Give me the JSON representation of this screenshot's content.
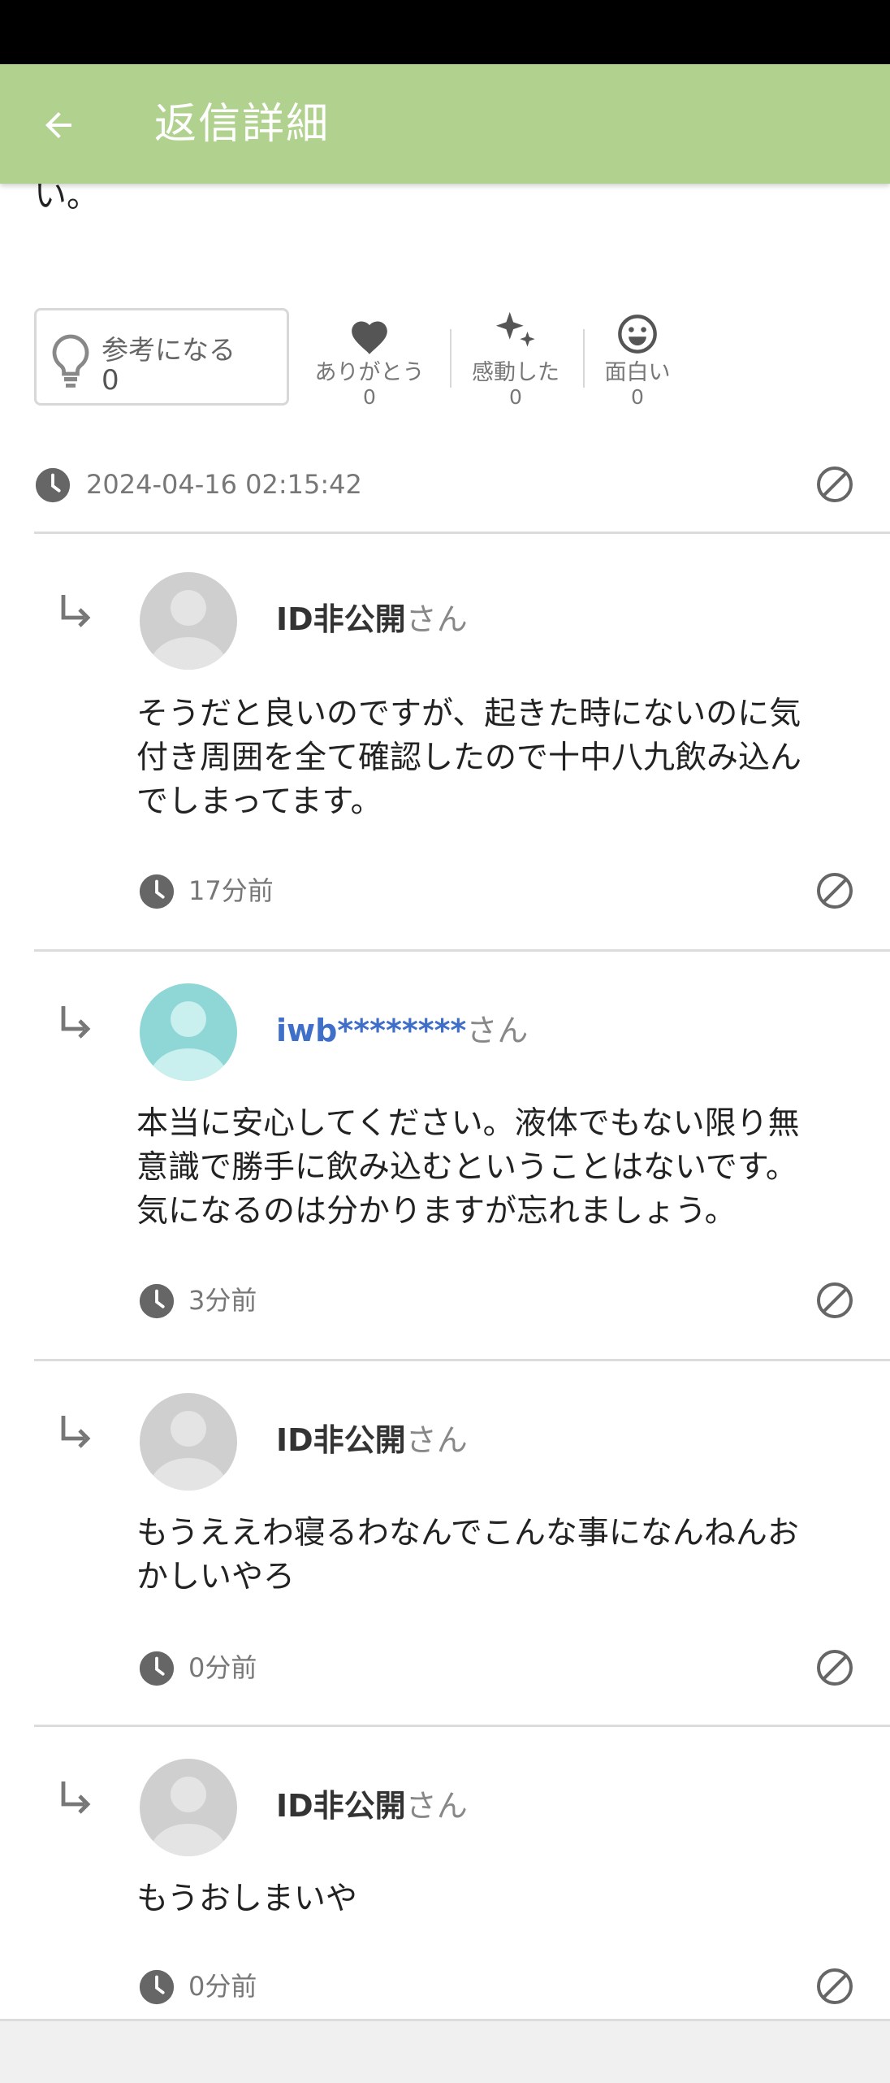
{
  "header": {
    "title": "返信詳細",
    "back_icon": "arrow-left-icon"
  },
  "truncated_text": "い。",
  "reactions": {
    "helpful": {
      "label": "参考になる",
      "count": "0"
    },
    "items": [
      {
        "label": "ありがとう",
        "count": "0",
        "icon": "heart-icon"
      },
      {
        "label": "感動した",
        "count": "0",
        "icon": "sparkle-icon"
      },
      {
        "label": "面白い",
        "count": "0",
        "icon": "smiley-icon"
      }
    ]
  },
  "post_timestamp": "2024-04-16 02:15:42",
  "replies": [
    {
      "user_id": "ID非公開",
      "honorific": "さん",
      "lines": [
        "そうだと良いのですが、起きた時にないのに気",
        "付き周囲を全て確認したので十中八九飲み込ん",
        "でしまってます。"
      ],
      "time": "17分前"
    },
    {
      "user_id": "iwb********",
      "honorific": "さん",
      "lines": [
        "本当に安心してください。液体でもない限り無",
        "意識で勝手に飲み込むということはないです。",
        "気になるのは分かりますが忘れましょう。"
      ],
      "time": "3分前"
    },
    {
      "user_id": "ID非公開",
      "honorific": "さん",
      "lines": [
        "もうええわ寝るわなんでこんな事になんねんお",
        "かしいやろ"
      ],
      "time": "0分前"
    },
    {
      "user_id": "ID非公開",
      "honorific": "さん",
      "lines": [
        "もうおしまいや"
      ],
      "time": "0分前"
    }
  ],
  "colors": {
    "appbar": "#b1d28f",
    "avatar_default": "#cfcfcf",
    "avatar_teal": "#8fd6d6",
    "link_blue": "#3f6fc8"
  }
}
